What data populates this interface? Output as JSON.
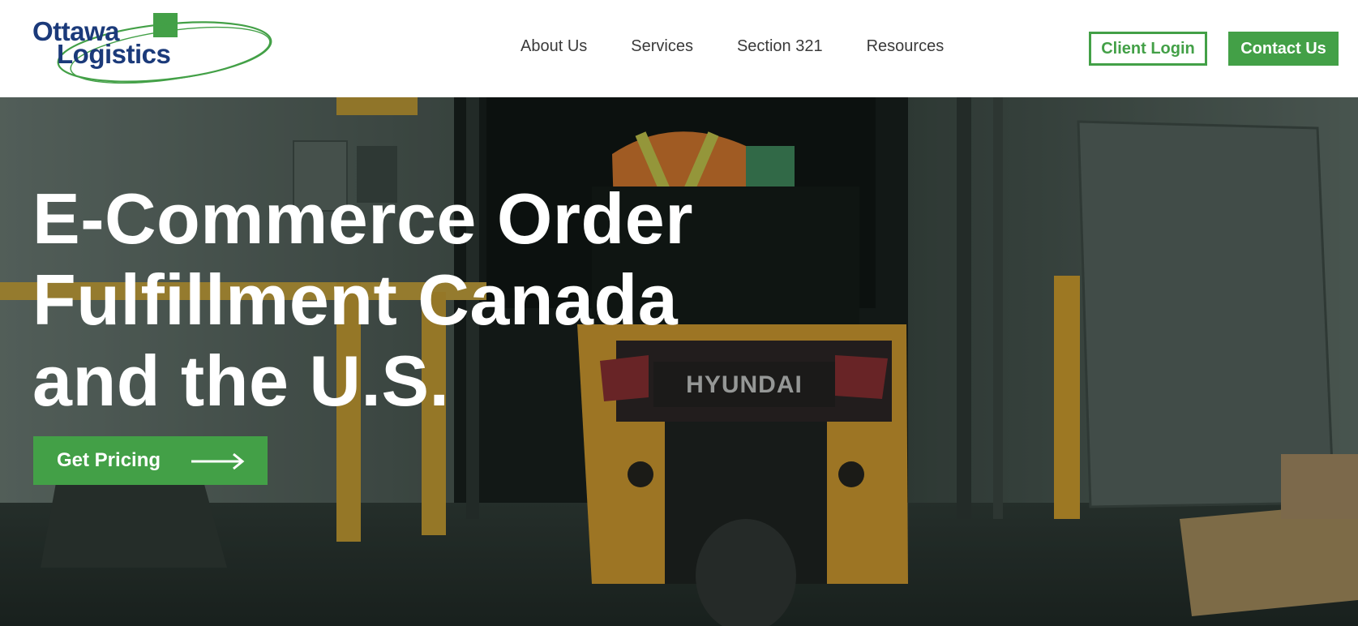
{
  "brand": {
    "line1": "Ottawa",
    "line2": "Logistics",
    "primary_color": "#43a047",
    "navy_color": "#1b3a7a"
  },
  "nav": {
    "items": [
      "About Us",
      "Services",
      "Section 321",
      "Resources"
    ]
  },
  "header_actions": {
    "client_login": "Client Login",
    "contact_us": "Contact Us"
  },
  "hero": {
    "title_lines": [
      "E-Commerce Order",
      "Fulfillment Canada",
      "and the U.S."
    ],
    "cta_label": "Get Pricing",
    "cta_icon": "arrow-right-icon",
    "forklift_brand": "HYUNDAI"
  }
}
